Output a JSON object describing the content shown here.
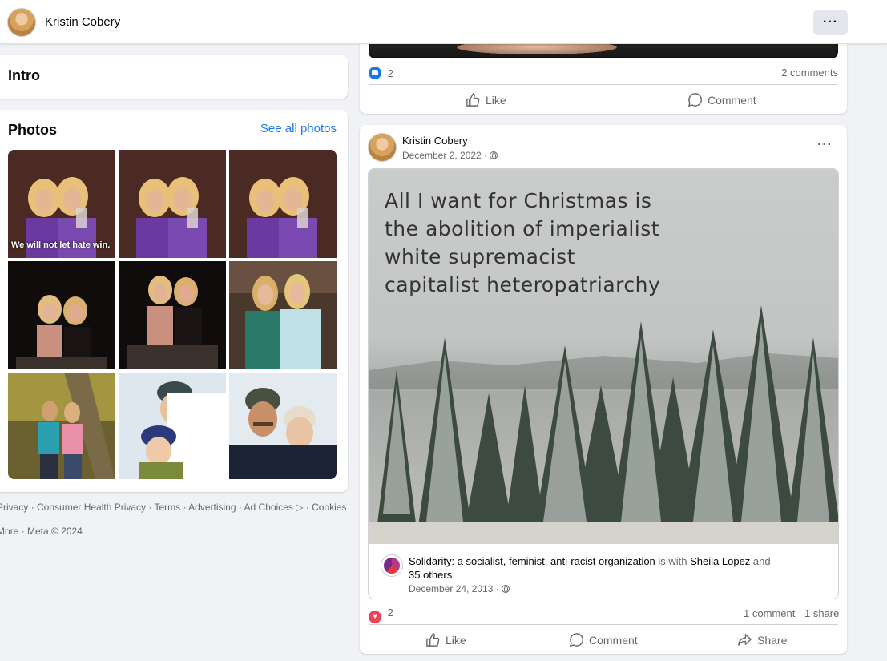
{
  "topbar": {
    "profile_name": "Kristin Cobery",
    "more_label": "···"
  },
  "intro": {
    "title": "Intro"
  },
  "photos": {
    "title": "Photos",
    "see_all": "See all photos",
    "items": [
      {
        "name": "photo-1",
        "caption": "We will not let hate win."
      },
      {
        "name": "photo-2"
      },
      {
        "name": "photo-3"
      },
      {
        "name": "photo-4"
      },
      {
        "name": "photo-5"
      },
      {
        "name": "photo-6"
      },
      {
        "name": "photo-7"
      },
      {
        "name": "photo-8"
      },
      {
        "name": "photo-9"
      }
    ]
  },
  "footer": {
    "line1": "Privacy · Consumer Health Privacy · Terms · Advertising · Ad Choices ▷ · Cookies ·",
    "line2": "More · Meta © 2024"
  },
  "post_top": {
    "likes": "2",
    "comments": "2 comments",
    "like_label": "Like",
    "comment_label": "Comment"
  },
  "post_main": {
    "author": "Kristin Cobery",
    "date": "December 2, 2022 ·",
    "dots": "···",
    "image_text": [
      "All I want for Christmas is",
      "the abolition of imperialist",
      "white supremacist",
      "capitalist heteropatriarchy"
    ],
    "shared": {
      "org_name": "Solidarity: a socialist, feminist, anti-racist organization",
      "with_text": " is with ",
      "with_person": "Sheila Lopez",
      "and_text": " and",
      "others": "35 others",
      "others_tail": ".",
      "date": "December 24, 2013 ·"
    },
    "reactions": "2",
    "comments": "1 comment",
    "shares": "1 share",
    "like_label": "Like",
    "comment_label": "Comment",
    "share_label": "Share"
  }
}
